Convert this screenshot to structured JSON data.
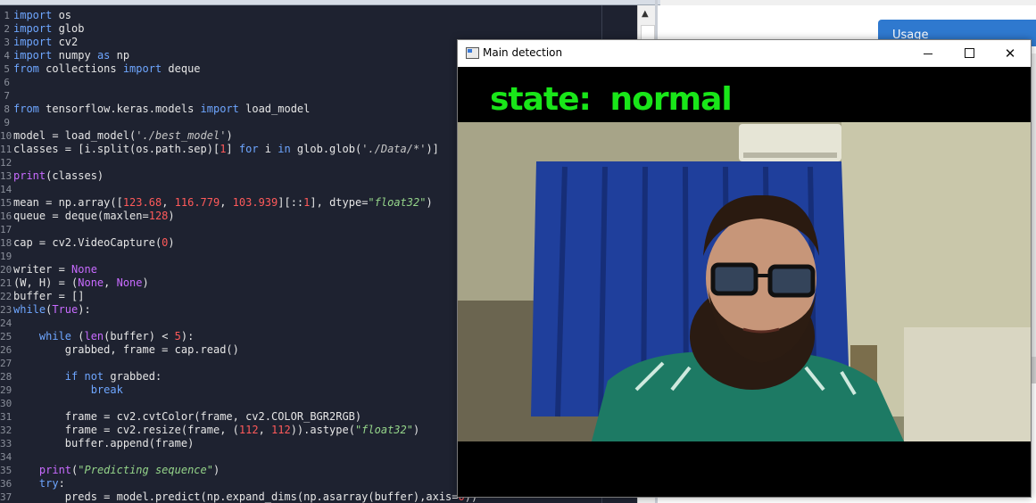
{
  "editor": {
    "lines": [
      {
        "n": "1",
        "html": "<span class=\"kw\">import</span> os"
      },
      {
        "n": "2",
        "html": "<span class=\"kw\">import</span> glob"
      },
      {
        "n": "3",
        "html": "<span class=\"kw\">import</span> cv2"
      },
      {
        "n": "4",
        "html": "<span class=\"kw\">import</span> numpy <span class=\"kw\">as</span> np"
      },
      {
        "n": "5",
        "html": "<span class=\"kw\">from</span> collections <span class=\"kw\">import</span> deque"
      },
      {
        "n": "6",
        "html": ""
      },
      {
        "n": "7",
        "html": ""
      },
      {
        "n": "8",
        "html": "<span class=\"kw\">from</span> tensorflow.keras.models <span class=\"kw\">import</span> load_model"
      },
      {
        "n": "9",
        "html": ""
      },
      {
        "n": "10",
        "html": "model = load_model(<span class=\"str\">'./best_model'</span>)"
      },
      {
        "n": "11",
        "html": "classes = [i.split(os.path.sep)[<span class=\"num\">1</span>] <span class=\"kw\">for</span> i <span class=\"kw\">in</span> glob.glob(<span class=\"str\">'./Data/*'</span>)]"
      },
      {
        "n": "12",
        "html": ""
      },
      {
        "n": "13",
        "html": "<span class=\"bi\">print</span>(classes)"
      },
      {
        "n": "14",
        "html": ""
      },
      {
        "n": "15",
        "html": "mean = np.array([<span class=\"num\">123.68</span>, <span class=\"num\">116.779</span>, <span class=\"num\">103.939</span>][::<span class=\"num\">1</span>], dtype=<span class=\"strg\">\"float32\"</span>)"
      },
      {
        "n": "16",
        "html": "queue = deque(maxlen=<span class=\"num\">128</span>)"
      },
      {
        "n": "17",
        "html": ""
      },
      {
        "n": "18",
        "html": "cap = cv2.VideoCapture(<span class=\"num\">0</span>)"
      },
      {
        "n": "19",
        "html": ""
      },
      {
        "n": "20",
        "html": "writer = <span class=\"bi\">None</span>"
      },
      {
        "n": "21",
        "html": "(W, H) = (<span class=\"bi\">None</span>, <span class=\"bi\">None</span>)"
      },
      {
        "n": "22",
        "html": "buffer = []"
      },
      {
        "n": "23",
        "html": "<span class=\"kw\">while</span>(<span class=\"bi\">True</span>):"
      },
      {
        "n": "24",
        "html": ""
      },
      {
        "n": "25",
        "html": "    <span class=\"kw\">while</span> (<span class=\"bi\">len</span>(buffer) &lt; <span class=\"num\">5</span>):"
      },
      {
        "n": "26",
        "html": "        grabbed, frame = cap.read()"
      },
      {
        "n": "27",
        "html": ""
      },
      {
        "n": "28",
        "html": "        <span class=\"kw\">if not</span> grabbed:"
      },
      {
        "n": "29",
        "html": "            <span class=\"kw\">break</span>"
      },
      {
        "n": "30",
        "html": ""
      },
      {
        "n": "31",
        "html": "        frame = cv2.cvtColor(frame, cv2.COLOR_BGR2RGB)"
      },
      {
        "n": "32",
        "html": "        frame = cv2.resize(frame, (<span class=\"num\">112</span>, <span class=\"num\">112</span>)).astype(<span class=\"strg\">\"float32\"</span>)"
      },
      {
        "n": "33",
        "html": "        buffer.append(frame)"
      },
      {
        "n": "34",
        "html": ""
      },
      {
        "n": "35",
        "html": "    <span class=\"bi\">print</span>(<span class=\"strg\">\"Predicting sequence\"</span>)"
      },
      {
        "n": "36",
        "html": "    <span class=\"kw\">try</span>:"
      },
      {
        "n": "37",
        "html": "        preds = model.predict(np.expand_dims(np.asarray(buffer),axis=<span class=\"num\">0</span>))"
      }
    ]
  },
  "right_panel": {
    "usage_label": "Usage"
  },
  "window": {
    "title": "Main detection",
    "minimize": "",
    "maximize": "",
    "close": "✕",
    "state_text": "state:  normal"
  },
  "colors": {
    "state_green": "#19e619",
    "editor_bg": "#1e2230",
    "usage_blue": "#2f79cf"
  }
}
